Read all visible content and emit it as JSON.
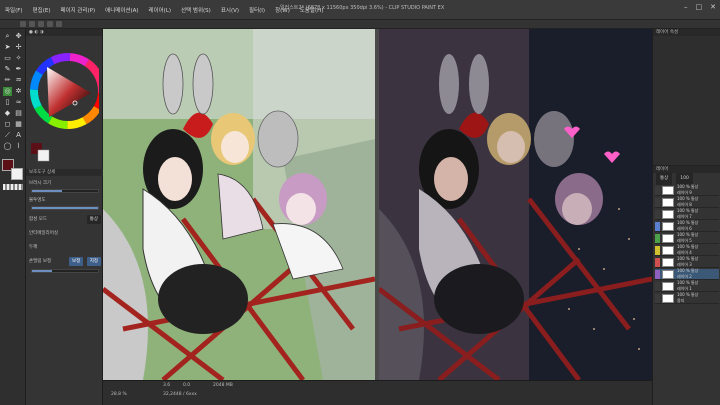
{
  "window": {
    "title": "일러스트2* (6878 x 11560px 350dpi 3.6%) - CLIP STUDIO PAINT EX",
    "controls": [
      "–",
      "□",
      "✕"
    ]
  },
  "menu": [
    "파일(F)",
    "편집(E)",
    "페이지 관리(P)",
    "애니메이션(A)",
    "레이어(L)",
    "선택 범위(S)",
    "표시(V)",
    "필터(I)",
    "창(W)",
    "도움말(H)"
  ],
  "tool_property": {
    "header": "보조도구 상세",
    "brush_size_label": "브러시 크기",
    "opacity_label": "불투명도",
    "blend_label": "합성 모드",
    "blend_value": "통상",
    "antialias_label": "안티에일리어싱",
    "thickness_label": "두께",
    "stabilize_label": "손떨림 보정",
    "chip_a": "보정",
    "chip_b": "지정"
  },
  "status": {
    "zoom": "3.6",
    "angle": "0.0",
    "left_info": "28.8 %",
    "memory": "2048 MB",
    "position": "32,2448 / 6xxx"
  },
  "right_panel": {
    "header_top": "레이어 속성",
    "header_bottom": "레이어",
    "blend": "통상",
    "opacity": "100",
    "layers": [
      {
        "name": "100 % 통상",
        "sub": "레이어 9",
        "color": "#3a3a3a"
      },
      {
        "name": "100 % 통상",
        "sub": "레이어 8",
        "color": "#3a3a3a"
      },
      {
        "name": "100 % 통상",
        "sub": "레이어 7",
        "color": "#3a3a3a"
      },
      {
        "name": "100 % 통상",
        "sub": "레이어 6",
        "color": "#5a7fd0"
      },
      {
        "name": "100 % 통상",
        "sub": "레이어 5",
        "color": "#4ca04c"
      },
      {
        "name": "100 % 통상",
        "sub": "레이어 4",
        "color": "#d0c030"
      },
      {
        "name": "100 % 통상",
        "sub": "레이어 3",
        "color": "#d05050"
      },
      {
        "name": "100 % 통상",
        "sub": "레이어 2",
        "color": "#9060c0"
      },
      {
        "name": "100 % 통상",
        "sub": "레이어 1",
        "color": "#3a3a3a"
      },
      {
        "name": "100 % 통상",
        "sub": "용지",
        "color": "#3a3a3a"
      }
    ]
  },
  "colors": {
    "main_color": "#5a1016",
    "sub_color": "#f2f2f2"
  },
  "sliders": {
    "brush_size": 0.45,
    "opacity": 1.0,
    "stabilize": 0.3
  }
}
